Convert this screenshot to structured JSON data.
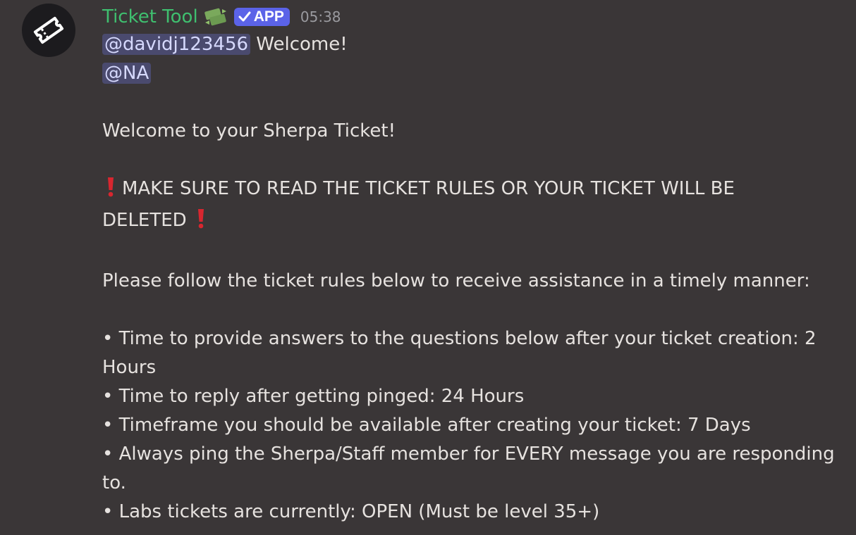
{
  "author": {
    "name": "Ticket Tool",
    "role_icon": "money-exchange-icon",
    "badge_label": "APP",
    "timestamp": "05:38",
    "avatar_icon": "ticket-icon",
    "name_color": "#3fbf6f",
    "badge_color": "#5b63e8"
  },
  "message": {
    "mention_user": "@davidj123456",
    "welcome_text": " Welcome!",
    "mention_role": "@NA",
    "intro": "Welcome to your Sherpa Ticket!",
    "warning_line1": "MAKE SURE TO READ THE TICKET RULES OR YOUR TICKET WILL BE",
    "warning_line2": "DELETED",
    "warning_icon": "red-exclamation-icon",
    "rules_intro": "Please follow the ticket rules below to receive assistance in a timely manner:",
    "rules": [
      "• Time to provide answers to the questions below after your ticket creation: 2",
      "Hours",
      "• Time to reply after getting pinged: 24 Hours",
      "• Timeframe you should be available after creating your ticket:  7 Days",
      "• Always ping the Sherpa/Staff member for EVERY message you are responding",
      "to.",
      "• Labs tickets are currently: OPEN (Must be level 35+)"
    ]
  },
  "colors": {
    "background": "#3a3637",
    "mention_bg": "#4a4a6e",
    "mention_text": "#d6d9fd",
    "exclamation": "#d8262f"
  }
}
